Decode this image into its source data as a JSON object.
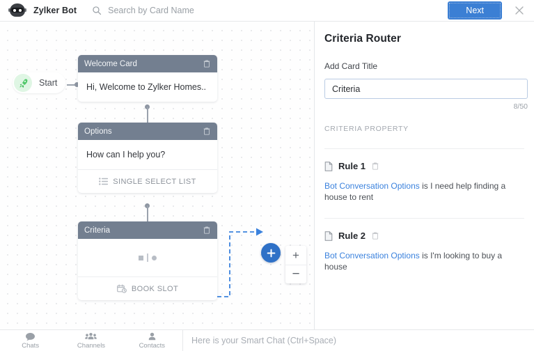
{
  "topbar": {
    "logo_name": "bot-avatar",
    "bot_name": "Zylker Bot",
    "search_placeholder": "Search by Card Name",
    "search_value": "",
    "next_label": "Next",
    "close_label": "×"
  },
  "canvas": {
    "start": {
      "label": "Start",
      "icon": "rocket-icon"
    },
    "cards": [
      {
        "id": "welcome",
        "title": "Welcome Card",
        "body": "Hi, Welcome to Zylker Homes..",
        "footer": null
      },
      {
        "id": "options",
        "title": "Options",
        "body": "How can I help you?",
        "footer": "SINGLE SELECT LIST"
      },
      {
        "id": "criteria",
        "title": "Criteria",
        "body": "",
        "footer": "BOOK SLOT"
      }
    ],
    "add_button_label": "+",
    "zoom_in_label": "+",
    "zoom_out_label": "−"
  },
  "panel": {
    "title": "Criteria Router",
    "card_title_label": "Add Card Title",
    "card_title_value": "Criteria",
    "card_title_placeholder": "Enter card title",
    "char_count": "8/50",
    "section_header": "CRITERIA PROPERTY",
    "rules": [
      {
        "name": "Rule 1",
        "link_text": "Bot Conversation Options",
        "condition": " is I need help finding a house to rent"
      },
      {
        "name": "Rule 2",
        "link_text": "Bot Conversation Options",
        "condition": " is I'm looking to buy a house"
      }
    ]
  },
  "bottombar": {
    "nav": [
      {
        "label": "Chats",
        "icon": "chat-bubble-icon"
      },
      {
        "label": "Channels",
        "icon": "group-icon"
      },
      {
        "label": "Contacts",
        "icon": "person-icon"
      }
    ],
    "smart_chat_text": "Here is your Smart Chat (Ctrl+Space)"
  },
  "colors": {
    "accent_blue": "#3b7fd4",
    "card_header": "#737f90",
    "link_blue": "#3b82dd",
    "start_green": "#51c96a"
  }
}
